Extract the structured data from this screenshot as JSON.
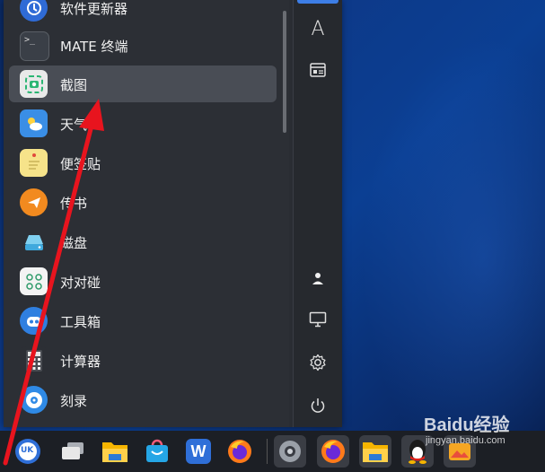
{
  "start_menu": {
    "apps": [
      {
        "label": "软件更新器",
        "icon": "software-updater-icon"
      },
      {
        "label": "MATE 终端",
        "icon": "terminal-icon"
      },
      {
        "label": "截图",
        "icon": "screenshot-icon"
      },
      {
        "label": "天气",
        "icon": "weather-icon"
      },
      {
        "label": "便签贴",
        "icon": "sticky-notes-icon"
      },
      {
        "label": "传书",
        "icon": "transfer-icon"
      },
      {
        "label": "磁盘",
        "icon": "disk-icon"
      },
      {
        "label": "对对碰",
        "icon": "game-icon"
      },
      {
        "label": "工具箱",
        "icon": "toolbox-icon"
      },
      {
        "label": "计算器",
        "icon": "calculator-icon"
      },
      {
        "label": "刻录",
        "icon": "burner-icon"
      }
    ],
    "selected": "截图"
  },
  "sidebar": {
    "buttons": [
      "all-apps-icon",
      "letter-sort-icon",
      "category-icon",
      "user-icon",
      "computer-icon",
      "settings-icon",
      "power-icon"
    ],
    "letter_sort_glyph": "A"
  },
  "terminal_glyph": ">_",
  "taskbar": {
    "items": [
      "start-menu-icon",
      "multitasking-icon",
      "file-manager-icon",
      "software-store-icon",
      "wps-writer-icon",
      "firefox-icon",
      "settings-icon",
      "firefox-icon",
      "file-manager-icon",
      "qq-icon",
      "image-viewer-icon"
    ],
    "wps_glyph": "W",
    "start_glyph": "UK"
  },
  "watermark": {
    "text": "Baidu经验",
    "subtext": "jingyan.baidu.com"
  },
  "colors": {
    "accent": "#3d7ee6",
    "arrow": "#e8141e"
  }
}
